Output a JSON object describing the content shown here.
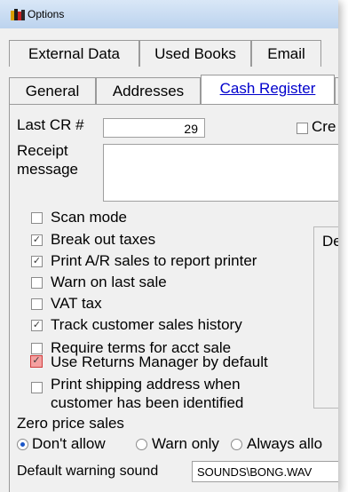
{
  "window": {
    "title": "Options"
  },
  "tabs_row1": [
    "External Data",
    "Used Books",
    "Email"
  ],
  "tabs_row2": [
    "General",
    "Addresses",
    "Cash Register"
  ],
  "form": {
    "last_cr_label": "Last CR #",
    "last_cr_value": "29",
    "create_checkbox_label": "Cre",
    "receipt_label_line1": "Receipt",
    "receipt_label_line2": "message",
    "group_label_partial": "De"
  },
  "options": [
    {
      "label": "Scan mode",
      "checked": false
    },
    {
      "label": "Break out taxes",
      "checked": true
    },
    {
      "label": "Print A/R sales to report printer",
      "checked": true
    },
    {
      "label": "Warn on last sale",
      "checked": false
    },
    {
      "label": "VAT tax",
      "checked": false
    },
    {
      "label": "Track customer sales history",
      "checked": true
    },
    {
      "label": "Require terms for acct sale",
      "checked": false
    },
    {
      "label": "Use Returns Manager by default",
      "checked": true,
      "highlighted": true
    }
  ],
  "print_shipping": {
    "line1": "Print shipping address when",
    "line2": "customer has been identified",
    "checked": false
  },
  "zero_price": {
    "label": "Zero price sales",
    "options": [
      "Don't allow",
      "Warn only",
      "Always allo"
    ],
    "selected": "Don't allow"
  },
  "sound": {
    "label": "Default warning sound",
    "value": "SOUNDS\\BONG.WAV"
  },
  "colors": {
    "highlight": "#f4a0a0",
    "active_tab_text": "#0000cc"
  }
}
